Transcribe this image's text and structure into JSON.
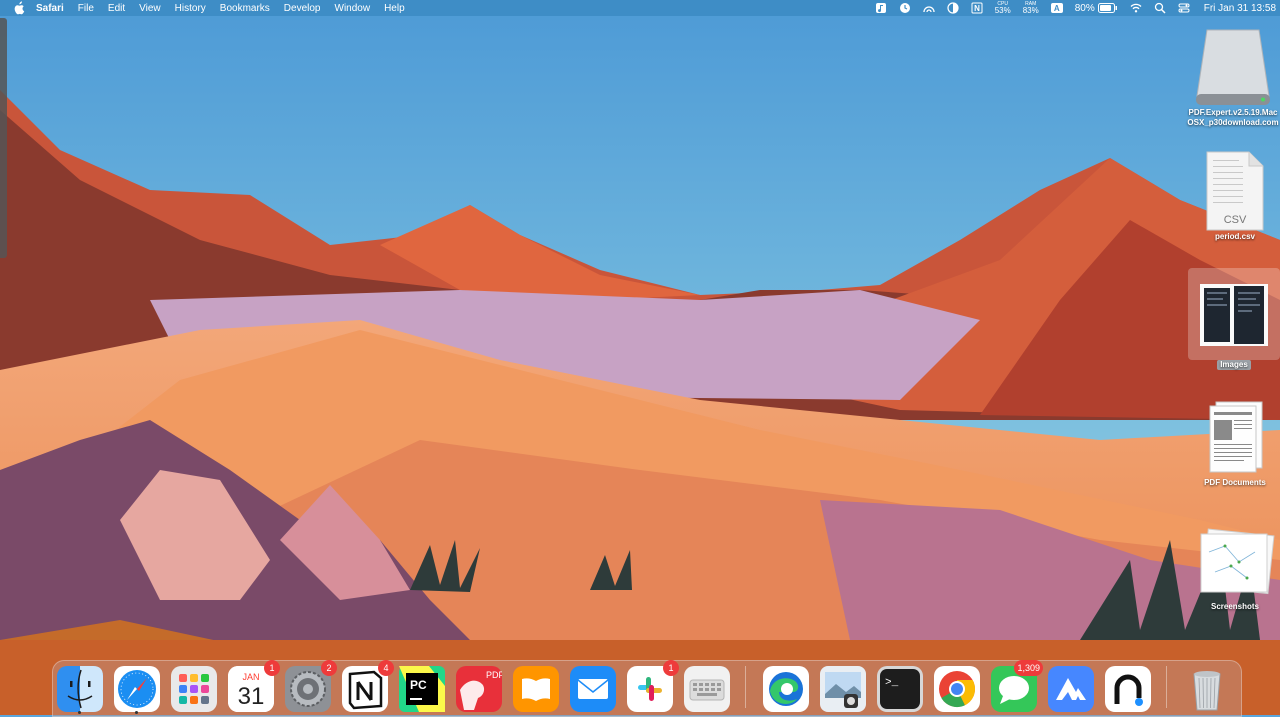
{
  "menubar": {
    "app_name": "Safari",
    "menus": [
      "File",
      "Edit",
      "View",
      "History",
      "Bookmarks",
      "Develop",
      "Window",
      "Help"
    ],
    "cpu_label": "CPU",
    "cpu_value": "53%",
    "ram_label": "RAM",
    "ram_value": "83%",
    "input_source": "A",
    "battery": "80%",
    "datetime": "Fri Jan 31  13:58",
    "color": "#3e8dc6"
  },
  "desktop": {
    "items": [
      {
        "label": "PDF.Expert.v2.5.19.MacOSX_p30download.com",
        "icon": "drive-icon"
      },
      {
        "label": "period.csv",
        "icon": "csv-file-icon",
        "file_type": "CSV"
      },
      {
        "label": "Images",
        "icon": "folder-preview-icon",
        "selected": true
      },
      {
        "label": "PDF Documents",
        "icon": "document-stack-icon"
      },
      {
        "label": "Screenshots",
        "icon": "screenshot-stack-icon"
      }
    ]
  },
  "dock": {
    "apps": [
      {
        "name": "Finder",
        "icon": "finder-icon",
        "running": true
      },
      {
        "name": "Safari",
        "icon": "safari-icon",
        "running": true
      },
      {
        "name": "Launchpad",
        "icon": "launchpad-icon"
      },
      {
        "name": "Calendar",
        "icon": "calendar-icon",
        "month": "JAN",
        "day": "31",
        "badge": "1"
      },
      {
        "name": "System Settings",
        "icon": "settings-icon",
        "badge": "2"
      },
      {
        "name": "Notion",
        "icon": "notion-icon",
        "badge": "4"
      },
      {
        "name": "PyCharm",
        "icon": "pycharm-icon",
        "text": "PC"
      },
      {
        "name": "PDF Expert",
        "icon": "pdf-expert-icon",
        "text": "PDF"
      },
      {
        "name": "Books",
        "icon": "books-icon"
      },
      {
        "name": "Mail",
        "icon": "mail-icon"
      },
      {
        "name": "Slack",
        "icon": "slack-icon",
        "badge": "1"
      },
      {
        "name": "Keyboard",
        "icon": "keyboard-icon"
      },
      {
        "name": "Edge",
        "icon": "edge-icon"
      },
      {
        "name": "Preview",
        "icon": "preview-icon"
      },
      {
        "name": "Terminal",
        "icon": "terminal-icon",
        "text": ">_"
      },
      {
        "name": "Chrome",
        "icon": "chrome-icon"
      },
      {
        "name": "Messages",
        "icon": "messages-icon",
        "badge": "1,309"
      },
      {
        "name": "NordVPN",
        "icon": "nordvpn-icon"
      },
      {
        "name": "Network app",
        "icon": "network-app-icon"
      },
      {
        "name": "Trash",
        "icon": "trash-icon"
      }
    ]
  }
}
